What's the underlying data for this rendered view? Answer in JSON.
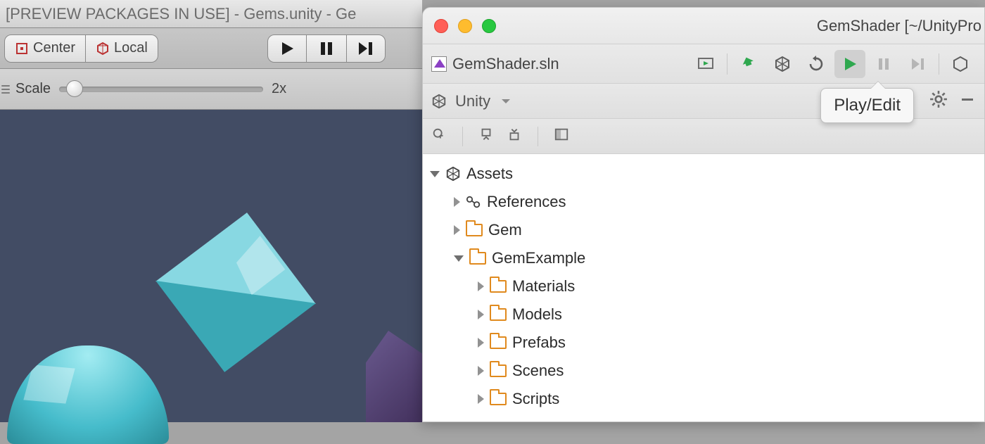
{
  "unity": {
    "title": "[PREVIEW PACKAGES IN USE] - Gems.unity - Ge",
    "center_label": "Center",
    "local_label": "Local",
    "scale_label": "Scale",
    "scale_value": "2x"
  },
  "rider": {
    "title": "GemShader [~/UnityPro",
    "solution_name": "GemShader.sln",
    "config_dropdown": "Unity",
    "tooltip": "Play/Edit",
    "tree": {
      "root": "Assets",
      "references": "References",
      "gem": "Gem",
      "gem_example": "GemExample",
      "materials": "Materials",
      "models": "Models",
      "prefabs": "Prefabs",
      "scenes": "Scenes",
      "scripts": "Scripts"
    }
  }
}
